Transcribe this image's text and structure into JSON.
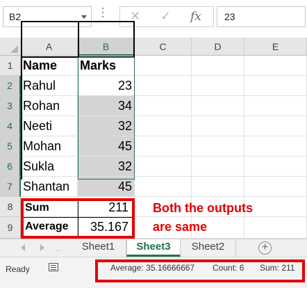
{
  "formula_bar": {
    "name_box": "B2",
    "cancel_icon": "✕",
    "enter_icon": "✓",
    "fx_label": "fx",
    "value": "23"
  },
  "columns": [
    "A",
    "B",
    "C",
    "D",
    "E"
  ],
  "rows": [
    "1",
    "2",
    "3",
    "4",
    "5",
    "6",
    "7",
    "8",
    "9"
  ],
  "cells": {
    "A1": "Name",
    "B1": "Marks",
    "A2": "Rahul",
    "B2": "23",
    "A3": "Rohan",
    "B3": "34",
    "A4": "Neeti",
    "B4": "32",
    "A5": "Mohan",
    "B5": "45",
    "A6": "Sukla",
    "B6": "32",
    "A7": "Shantan",
    "B7": "45",
    "A8": "Sum",
    "B8": "211",
    "A9": "Average",
    "B9": "35.167"
  },
  "annotation": {
    "line1": "Both the outputs",
    "line2": "are same",
    "color": "#e30000"
  },
  "sheet_tabs": {
    "tabs": [
      "Sheet1",
      "Sheet3",
      "Sheet2"
    ],
    "active": "Sheet3",
    "add_icon": "+"
  },
  "status_bar": {
    "ready": "Ready",
    "average": "Average: 35.16666667",
    "count": "Count: 6",
    "sum": "Sum: 211"
  },
  "colors": {
    "accent": "#217346",
    "highlight": "#e30000",
    "selection_fill": "#d4d4d4"
  }
}
